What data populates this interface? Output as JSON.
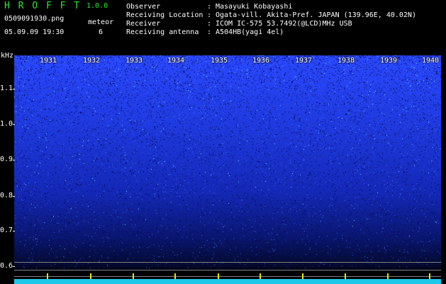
{
  "app": {
    "title": "H R O F F T",
    "version": "1.0.0"
  },
  "file": {
    "name": "0509091930.png",
    "datetime": "05.09.09 19:30"
  },
  "meteor": {
    "label": "meteor",
    "count": "6"
  },
  "info": [
    {
      "key": "Observer",
      "value": "Masayuki Kobayashi"
    },
    {
      "key": "Receiving Location",
      "value": "Ogata-vill. Akita-Pref. JAPAN (139.96E, 40.02N)"
    },
    {
      "key": "Receiver",
      "value": "ICOM IC-575 53.7492(@LCD)MHz USB"
    },
    {
      "key": "Receiving antenna",
      "value": "A504HB(yagi 4el)"
    }
  ],
  "colon": ":",
  "axis": {
    "unit": "kHz"
  },
  "minutes": [
    "1931",
    "1932",
    "1933",
    "1934",
    "1935",
    "1936",
    "1937",
    "1938",
    "1939",
    "1940"
  ],
  "yticks": [
    "1.1",
    "1.0",
    "0.9",
    "0.8",
    "0.7",
    "0.6"
  ],
  "colors": {
    "accent": "#2ee82e",
    "noise": "#2a48ff",
    "baseline": "#1ec8e8",
    "marker": "#e8e800"
  }
}
